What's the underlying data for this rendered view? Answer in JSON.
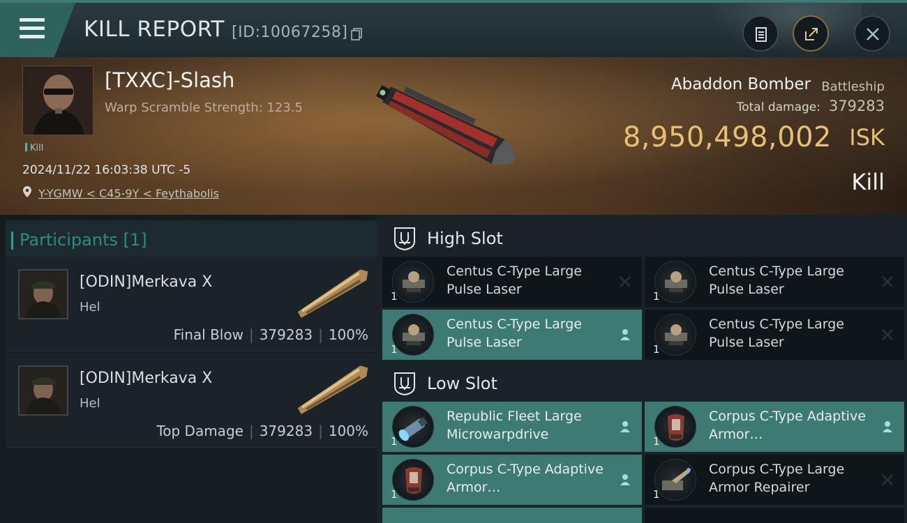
{
  "header": {
    "title": "KILL REPORT",
    "report_id": "[ID:10067258]"
  },
  "victim": {
    "name": "[TXXC]-Slash",
    "warp_scramble": "Warp Scramble Strength: 123.5",
    "tag": "Kill",
    "datetime": "2024/11/22 16:03:38 UTC -5",
    "location": "Y-YGMW < C45-9Y < Feythabolis",
    "ship_name": "Abaddon Bomber",
    "ship_class": "Battleship",
    "total_damage_label": "Total damage:",
    "total_damage": "379283",
    "isk_value": "8,950,498,002",
    "isk_unit": "ISK",
    "result": "Kill"
  },
  "participants": {
    "header": "Participants [1]",
    "rows": [
      {
        "name": "[ODIN]Merkava X",
        "ship": "Hel",
        "role": "Final Blow",
        "damage": "379283",
        "percent": "100%"
      },
      {
        "name": "[ODIN]Merkava X",
        "ship": "Hel",
        "role": "Top Damage",
        "damage": "379283",
        "percent": "100%"
      }
    ]
  },
  "fitting": {
    "high_slot_label": "High Slot",
    "low_slot_label": "Low Slot",
    "high": [
      {
        "qty": "1",
        "name": "Centus C-Type Large Pulse Laser",
        "status": "destroyed"
      },
      {
        "qty": "1",
        "name": "Centus C-Type Large Pulse Laser",
        "status": "destroyed"
      },
      {
        "qty": "1",
        "name": "Centus C-Type Large Pulse Laser",
        "status": "dropped"
      },
      {
        "qty": "1",
        "name": "Centus C-Type Large Pulse Laser",
        "status": "destroyed"
      }
    ],
    "low": [
      {
        "qty": "1",
        "name": "Republic Fleet Large Microwarpdrive",
        "status": "dropped"
      },
      {
        "qty": "1",
        "name": "Corpus C-Type Adaptive Armor…",
        "status": "dropped"
      },
      {
        "qty": "1",
        "name": "Corpus C-Type Adaptive Armor…",
        "status": "dropped"
      },
      {
        "qty": "1",
        "name": "Corpus C-Type Large Armor Repairer",
        "status": "destroyed"
      }
    ]
  },
  "colors": {
    "accent": "#3d7a73",
    "isk_gold": "#e9bf72",
    "header_teal": "#2e625d"
  }
}
